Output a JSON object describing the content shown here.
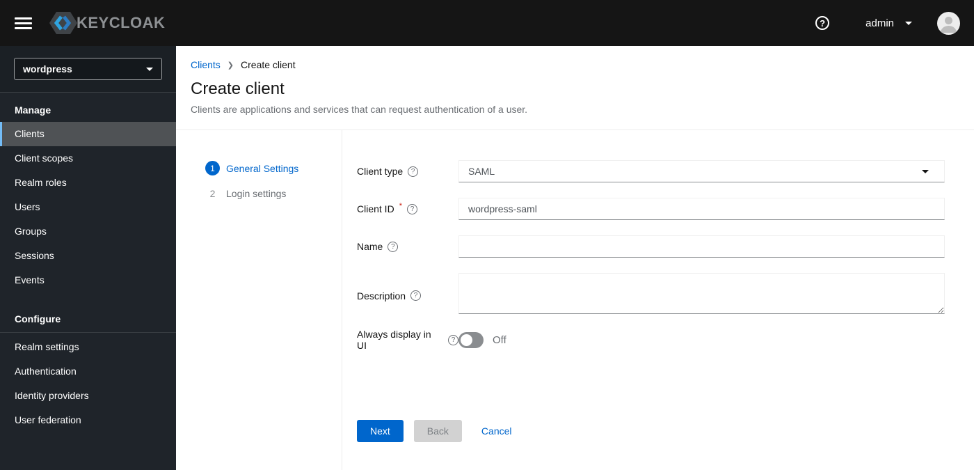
{
  "header": {
    "brand": "KEYCLOAK",
    "help_symbol": "?",
    "username": "admin"
  },
  "sidebar": {
    "realm": "wordpress",
    "sections": [
      {
        "title": "Manage",
        "items": [
          {
            "label": "Clients",
            "active": true
          },
          {
            "label": "Client scopes",
            "active": false
          },
          {
            "label": "Realm roles",
            "active": false
          },
          {
            "label": "Users",
            "active": false
          },
          {
            "label": "Groups",
            "active": false
          },
          {
            "label": "Sessions",
            "active": false
          },
          {
            "label": "Events",
            "active": false
          }
        ]
      },
      {
        "title": "Configure",
        "items": [
          {
            "label": "Realm settings",
            "active": false
          },
          {
            "label": "Authentication",
            "active": false
          },
          {
            "label": "Identity providers",
            "active": false
          },
          {
            "label": "User federation",
            "active": false
          }
        ]
      }
    ]
  },
  "breadcrumb": {
    "parent": "Clients",
    "separator": "❯",
    "current": "Create client"
  },
  "page": {
    "title": "Create client",
    "subtitle": "Clients are applications and services that can request authentication of a user."
  },
  "wizard": {
    "steps": [
      {
        "number": "1",
        "label": "General Settings",
        "active": true
      },
      {
        "number": "2",
        "label": "Login settings",
        "active": false
      }
    ]
  },
  "form": {
    "client_type": {
      "label": "Client type",
      "value": "SAML"
    },
    "client_id": {
      "label": "Client ID",
      "required_mark": "*",
      "value": "wordpress-saml"
    },
    "name": {
      "label": "Name",
      "value": ""
    },
    "description": {
      "label": "Description",
      "value": ""
    },
    "always_display": {
      "label": "Always display in UI",
      "state_label": "Off",
      "state": "off"
    },
    "help_symbol": "?"
  },
  "actions": {
    "next": "Next",
    "back": "Back",
    "cancel": "Cancel"
  },
  "colors": {
    "primary": "#0066cc",
    "header_bg": "#151515",
    "sidebar_bg": "#1f242a",
    "nav_active_bg": "#4f5255",
    "nav_active_border": "#73bcf7",
    "required": "#c9190b",
    "disabled_bg": "#d2d2d2"
  }
}
